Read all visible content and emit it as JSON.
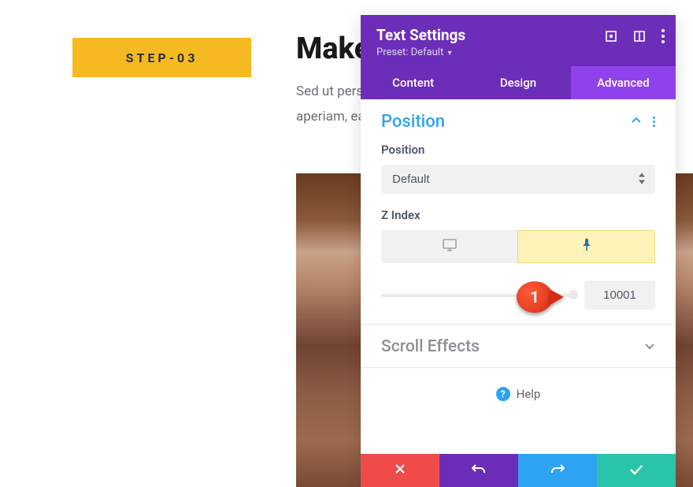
{
  "page": {
    "step_badge": "STEP-03",
    "heading": "Make",
    "body": "Sed ut perspiciatis unde omnis iste natus error sit acctotam rem aperiam, eaque ipsa quae ab illo inventore et sunt explicabo."
  },
  "panel": {
    "title": "Text Settings",
    "preset": "Preset: Default",
    "tabs": {
      "content": "Content",
      "design": "Design",
      "advanced": "Advanced"
    },
    "position_section": {
      "title": "Position",
      "position_label": "Position",
      "position_value": "Default",
      "zindex_label": "Z Index",
      "zindex_value": "10001"
    },
    "scroll_section": "Scroll Effects",
    "help": "Help"
  },
  "callout": {
    "number": "1"
  },
  "icons": {
    "expand": "expand-icon",
    "columns": "columns-icon",
    "kebab": "kebab-icon",
    "chevron_up": "chevron-up-icon",
    "chevron_down": "chevron-down-icon",
    "desktop": "desktop-icon",
    "pin": "pin-icon",
    "help": "help-icon",
    "close": "close-icon",
    "undo": "undo-icon",
    "redo": "redo-icon",
    "check": "check-icon"
  }
}
